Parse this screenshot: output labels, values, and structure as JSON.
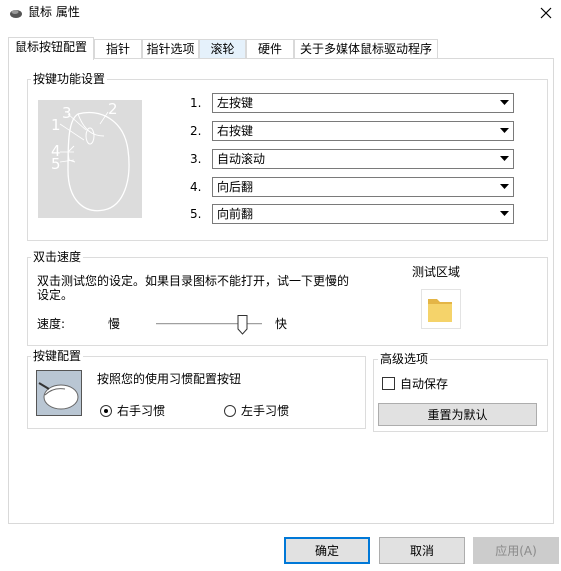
{
  "window": {
    "title": "鼠标 属性",
    "close_icon": "close-icon"
  },
  "tabs": [
    {
      "label": "鼠标按钮配置",
      "active": true
    },
    {
      "label": "指针"
    },
    {
      "label": "指针选项"
    },
    {
      "label": "滚轮",
      "hover": true
    },
    {
      "label": "硬件"
    },
    {
      "label": "关于多媒体鼠标驱动程序"
    }
  ],
  "button_config": {
    "group_label": "按键功能设置",
    "mouse_image_labels": [
      "1",
      "2",
      "3",
      "4",
      "5"
    ],
    "rows": [
      {
        "num": "1.",
        "value": "左按键"
      },
      {
        "num": "2.",
        "value": "右按键"
      },
      {
        "num": "3.",
        "value": "自动滚动"
      },
      {
        "num": "4.",
        "value": "向后翻"
      },
      {
        "num": "5.",
        "value": "向前翻"
      }
    ]
  },
  "double_click": {
    "group_label": "双击速度",
    "description_line1": "双击测试您的设定。如果目录图标不能打开，试一下更慢的",
    "description_line2": "设定。",
    "speed_label": "速度:",
    "slow_label": "慢",
    "fast_label": "快",
    "slider_level": 0.85,
    "test_area_label": "测试区域"
  },
  "key_config": {
    "group_label": "按键配置",
    "description": "按照您的使用习惯配置按钮",
    "right_hand_label": "右手习惯",
    "left_hand_label": "左手习惯",
    "selected": "right"
  },
  "advanced": {
    "group_label": "高级选项",
    "autosave_label": "自动保存",
    "autosave_checked": false,
    "reset_label": "重置为默认"
  },
  "footer": {
    "ok_label": "确定",
    "cancel_label": "取消",
    "apply_label": "应用(A)"
  },
  "colors": {
    "accent": "#0078d7",
    "folder": "#f5d36a"
  }
}
